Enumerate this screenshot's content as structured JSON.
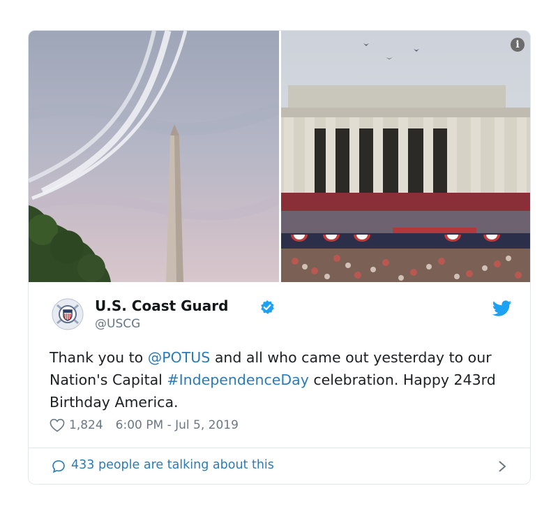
{
  "tweet": {
    "display_name": "U.S. Coast Guard",
    "handle": "@USCG",
    "text_parts": {
      "p1": "Thank you to ",
      "mention": "@POTUS",
      "p2": " and all who came out yesterday to our Nation's Capital ",
      "hashtag": "#IndependenceDay",
      "p3": " celebration. Happy 243rd Birthday America."
    },
    "likes": "1,824",
    "timestamp": "6:00 PM - Jul 5, 2019",
    "conversation": "433 people are talking about this"
  },
  "icons": {
    "info": "info-icon",
    "verified": "verified-badge-icon",
    "bird": "twitter-bird-icon",
    "heart": "heart-icon",
    "comment": "comment-bubble-icon",
    "chevron": "chevron-right-icon"
  },
  "colors": {
    "link": "#2b7bb9",
    "text": "#1c2022",
    "muted": "#697882",
    "twitter_blue": "#1da1f2",
    "border": "#e1e8ed"
  }
}
